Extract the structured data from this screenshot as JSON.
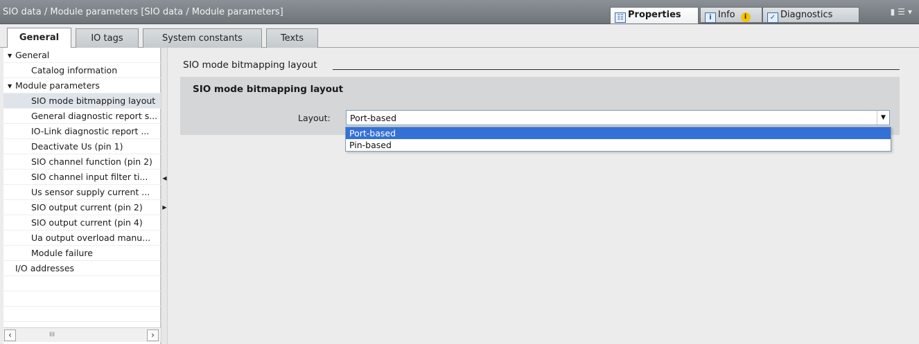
{
  "titlebar": {
    "title": "SIO data / Module parameters [SIO data / Module parameters]",
    "tabs": [
      {
        "label": "Properties",
        "icon": "properties-icon"
      },
      {
        "label": "Info",
        "icon": "info-icon"
      },
      {
        "label": "Diagnostics",
        "icon": "diagnostics-icon"
      }
    ],
    "info_badge": "i"
  },
  "editor_tabs": [
    "General",
    "IO tags",
    "System constants",
    "Texts"
  ],
  "nav": {
    "items": [
      {
        "label": "General",
        "level": 0,
        "expanded": true
      },
      {
        "label": "Catalog information",
        "level": 1
      },
      {
        "label": "Module parameters",
        "level": 0,
        "expanded": true
      },
      {
        "label": "SIO mode bitmapping layout",
        "level": 1,
        "selected": true
      },
      {
        "label": "General diagnostic report s...",
        "level": 1
      },
      {
        "label": "IO-Link diagnostic report ...",
        "level": 1
      },
      {
        "label": "Deactivate Us (pin 1)",
        "level": 1
      },
      {
        "label": "SIO channel function (pin 2)",
        "level": 1
      },
      {
        "label": "SIO channel input filter ti...",
        "level": 1
      },
      {
        "label": "Us sensor supply current ...",
        "level": 1
      },
      {
        "label": "SIO output current (pin 2)",
        "level": 1
      },
      {
        "label": "SIO output current (pin 4)",
        "level": 1
      },
      {
        "label": "Ua output overload manu...",
        "level": 1
      },
      {
        "label": "Module failure",
        "level": 1
      },
      {
        "label": "I/O addresses",
        "level": 0
      }
    ],
    "scroll_thumb": "III"
  },
  "main": {
    "section_heading": "SIO mode bitmapping layout",
    "group_title": "SIO mode bitmapping layout",
    "layout_label": "Layout:",
    "layout_value": "Port-based",
    "options": [
      "Port-based",
      "Pin-based"
    ],
    "highlighted_option": "Port-based"
  },
  "colors": {
    "selection": "#3471d6",
    "titlebar": "#7b8186",
    "group_bg": "#d4d6d8"
  }
}
